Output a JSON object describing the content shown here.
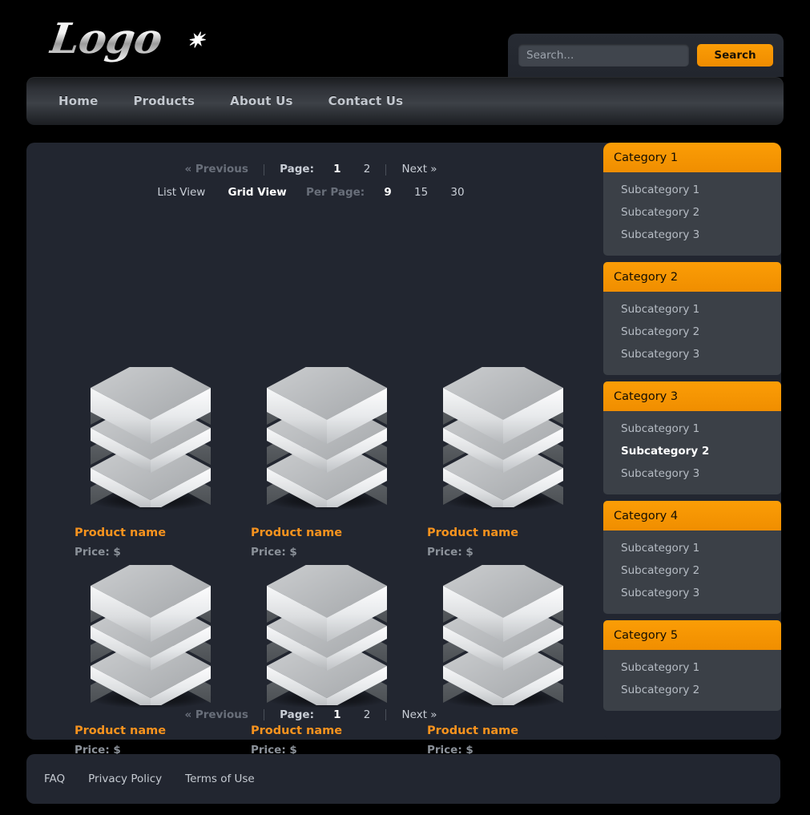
{
  "header": {
    "logo_text": "Logo",
    "logo_star_icon": "starburst-icon"
  },
  "search": {
    "placeholder": "Search...",
    "value": "",
    "button_label": "Search"
  },
  "nav": {
    "items": [
      {
        "label": "Home"
      },
      {
        "label": "Products"
      },
      {
        "label": "About Us"
      },
      {
        "label": "Contact Us"
      }
    ]
  },
  "toolbar": {
    "previous_label": "« Previous",
    "page_label": "Page:",
    "pages": [
      {
        "label": "1",
        "active": true
      },
      {
        "label": "2",
        "active": false
      }
    ],
    "next_label": "Next »",
    "list_view_label": "List View",
    "grid_view_label": "Grid View",
    "per_page_label": "Per Page:",
    "per_page_options": [
      {
        "label": "9",
        "active": true
      },
      {
        "label": "15",
        "active": false
      },
      {
        "label": "30",
        "active": false
      }
    ]
  },
  "products": [
    {
      "name": "Product name",
      "price": "Price: $"
    },
    {
      "name": "Product name",
      "price": "Price: $"
    },
    {
      "name": "Product name",
      "price": "Price: $"
    },
    {
      "name": "Product name",
      "price": "Price: $"
    },
    {
      "name": "Product name",
      "price": "Price: $"
    },
    {
      "name": "Product name",
      "price": "Price: $"
    }
  ],
  "sidebar": {
    "categories": [
      {
        "title": "Category 1",
        "subcategories": [
          {
            "label": "Subcategory 1",
            "active": false
          },
          {
            "label": "Subcategory 2",
            "active": false
          },
          {
            "label": "Subcategory 3",
            "active": false
          }
        ]
      },
      {
        "title": "Category 2",
        "subcategories": [
          {
            "label": "Subcategory 1",
            "active": false
          },
          {
            "label": "Subcategory 2",
            "active": false
          },
          {
            "label": "Subcategory 3",
            "active": false
          }
        ]
      },
      {
        "title": "Category 3",
        "subcategories": [
          {
            "label": "Subcategory 1",
            "active": false
          },
          {
            "label": "Subcategory 2",
            "active": true
          },
          {
            "label": "Subcategory 3",
            "active": false
          }
        ]
      },
      {
        "title": "Category 4",
        "subcategories": [
          {
            "label": "Subcategory 1",
            "active": false
          },
          {
            "label": "Subcategory 2",
            "active": false
          },
          {
            "label": "Subcategory 3",
            "active": false
          }
        ]
      },
      {
        "title": "Category 5",
        "subcategories": [
          {
            "label": "Subcategory 1",
            "active": false
          },
          {
            "label": "Subcategory 2",
            "active": false
          }
        ]
      }
    ]
  },
  "footer": {
    "links": [
      {
        "label": "FAQ"
      },
      {
        "label": "Privacy Policy"
      },
      {
        "label": "Terms of Use"
      }
    ]
  },
  "colors": {
    "accent_orange": "#f7931e",
    "button_orange": "#f08e00",
    "panel_dark": "#222630",
    "category_body": "#3b4047",
    "page_background": "#000000"
  }
}
